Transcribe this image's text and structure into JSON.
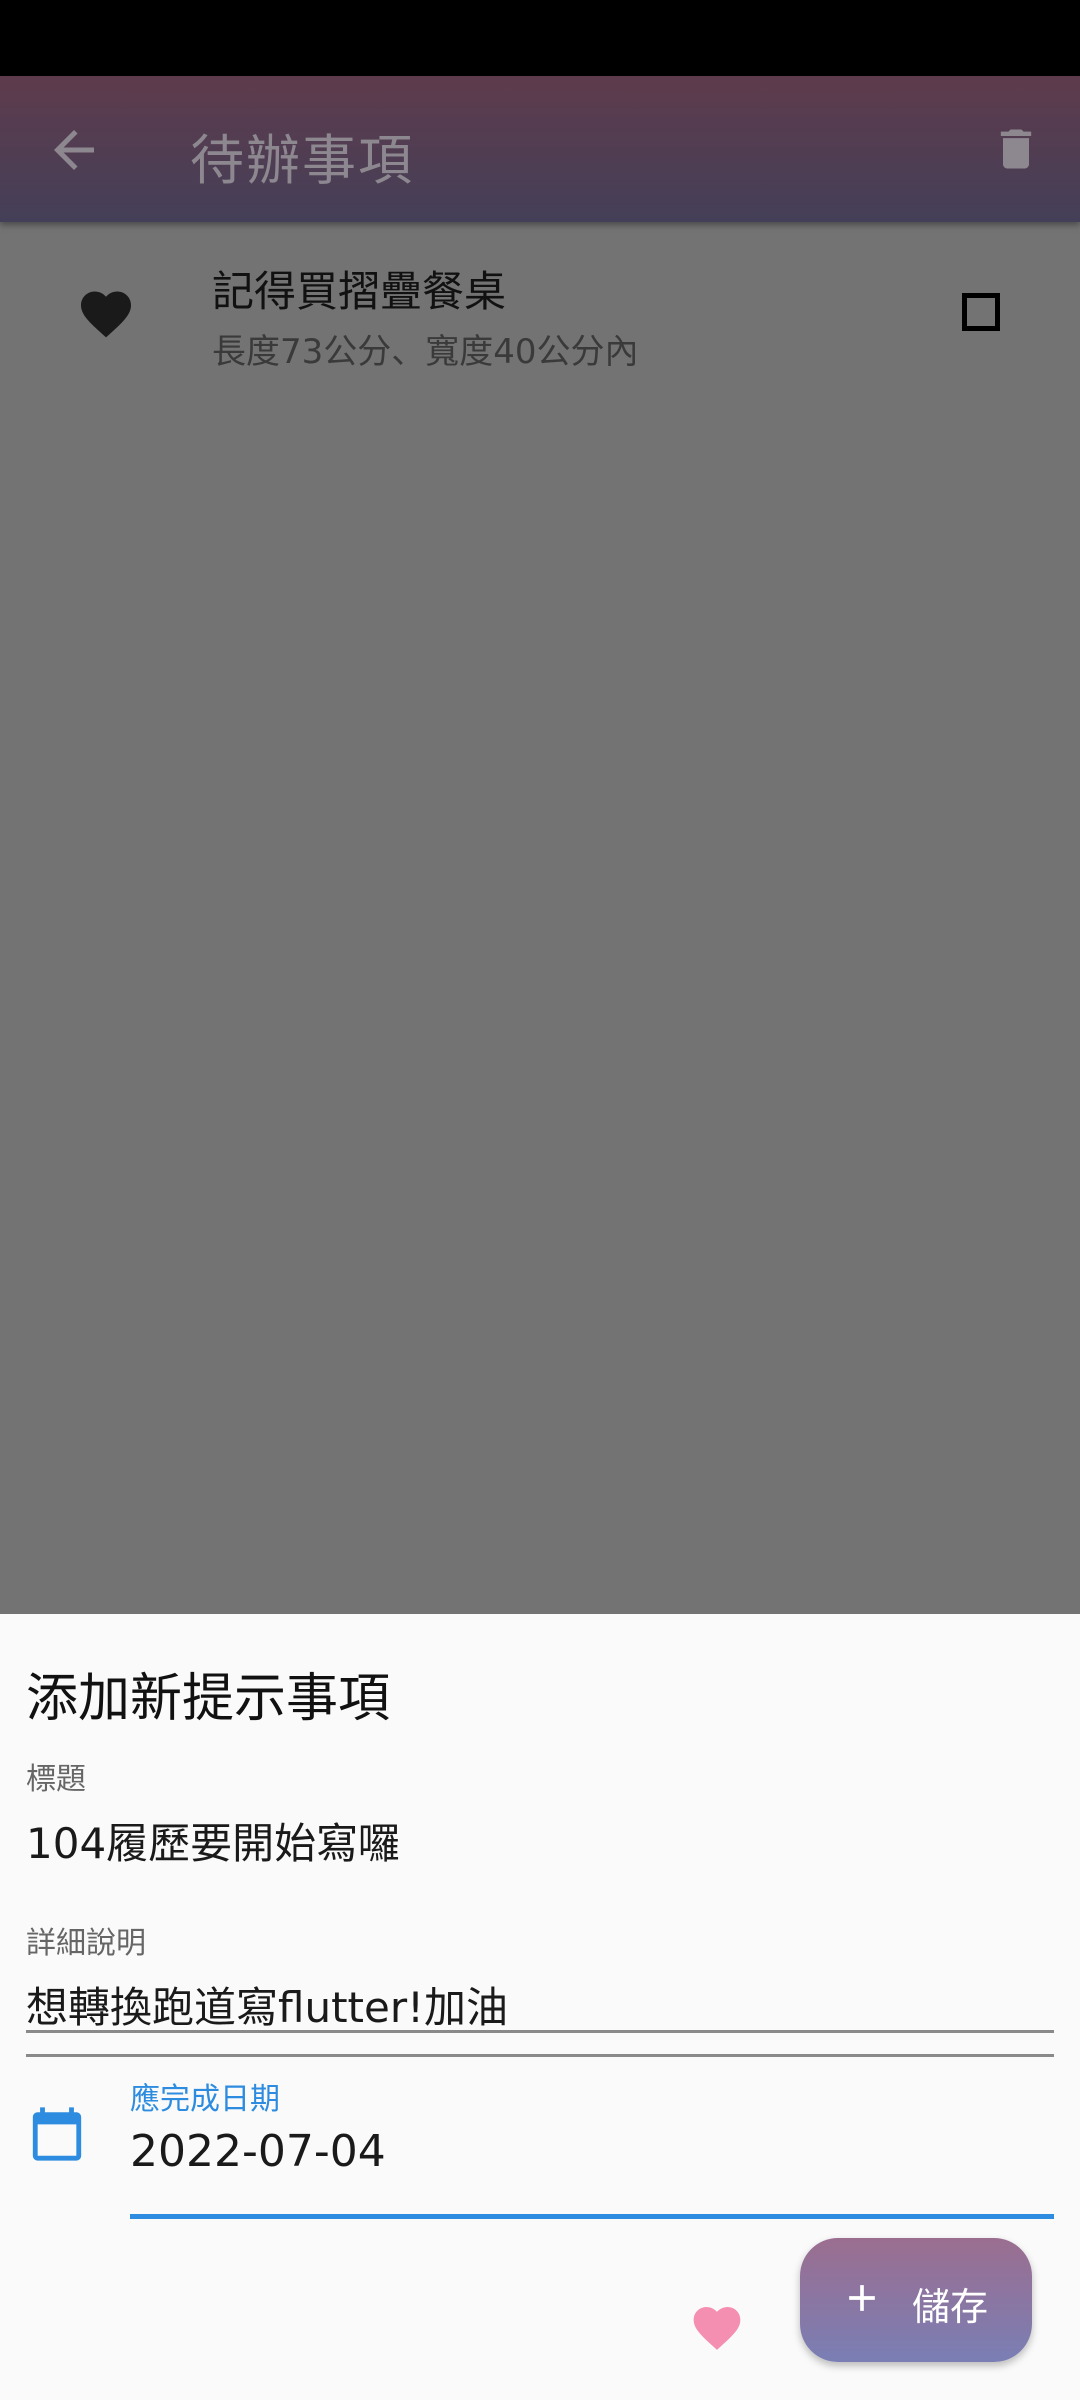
{
  "app_bar": {
    "title": "待辦事項"
  },
  "todo_items": [
    {
      "title": "記得買摺疊餐桌",
      "subtitle": "長度73公分、寬度40公分內",
      "checked": false
    }
  ],
  "dialog": {
    "title": "添加新提示事項",
    "title_field": {
      "label": "標題",
      "value": "104履歷要開始寫囉"
    },
    "detail_field": {
      "label": "詳細說明",
      "value": "想轉換跑道寫flutter!加油"
    },
    "date_field": {
      "label": "應完成日期",
      "value": "2022-07-04"
    },
    "save_label": "儲存"
  },
  "colors": {
    "accent": "#2d8ce0",
    "favorite": "#f48fb1",
    "app_bar_top": "#5e3b4c",
    "app_bar_bottom": "#443f58"
  },
  "icons": [
    "back-arrow-icon",
    "trash-icon",
    "heart-icon",
    "checkbox-icon",
    "calendar-icon",
    "plus-icon"
  ]
}
